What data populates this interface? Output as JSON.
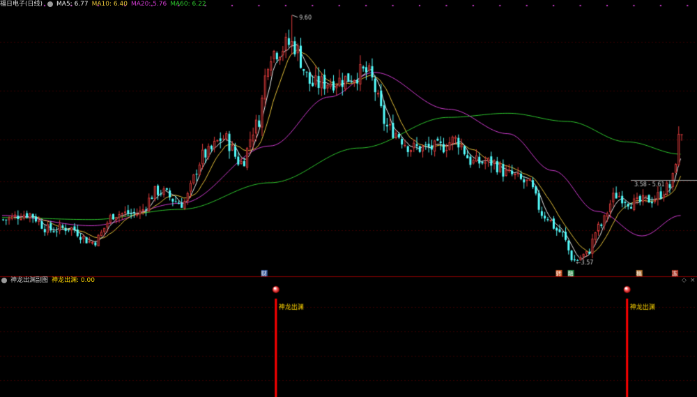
{
  "header": {
    "title": "福日电子(日线)",
    "ma": [
      {
        "label": "MA5: 6.77",
        "color": "#f0f0f0"
      },
      {
        "label": "MA10: 6.40",
        "color": "#e8c33a"
      },
      {
        "label": "MA20: 5.76",
        "color": "#d23cd2"
      },
      {
        "label": "MA60: 6.22",
        "color": "#2ec82e"
      }
    ]
  },
  "indicator": {
    "title": "神龙出渊副图",
    "value_label": "神龙出渊: 0.00",
    "signal_text": "神龙出渊",
    "signals": [
      92,
      210
    ]
  },
  "events": [
    {
      "index": 88,
      "text": "财",
      "color": "#ffffff",
      "bg": "#335599"
    },
    {
      "index": 187,
      "text": "转",
      "color": "#ffffff",
      "bg": "#cc5522"
    },
    {
      "index": 191,
      "text": "融",
      "color": "#ffffff",
      "bg": "#228844"
    },
    {
      "index": 214,
      "text": "稿",
      "color": "#ffffff",
      "bg": "#aa6622"
    },
    {
      "index": 226,
      "text": "冻",
      "color": "#ffffff",
      "bg": "#aa3322"
    }
  ],
  "annotations": {
    "high_label": "9.60",
    "low_label": "3.57",
    "range_label": "3.58 - 5.61"
  },
  "colors": {
    "up": "#e03c3c",
    "down": "#54ffff",
    "bg": "#000000",
    "panel_line": "#8b0000",
    "grid": "#3a0000",
    "ma5": "#f0f0f0",
    "ma10": "#e8c33a",
    "ma20": "#d23cd2",
    "ma60": "#2ec82e",
    "signal": "#ff0000",
    "signal_text": "#ffd700"
  },
  "chart_data": {
    "type": "candlestick",
    "price_range": [
      3.4,
      9.8
    ],
    "anchors": [
      [
        0,
        4.6
      ],
      [
        8,
        4.75
      ],
      [
        16,
        4.35
      ],
      [
        22,
        4.4
      ],
      [
        30,
        4.05
      ],
      [
        38,
        4.75
      ],
      [
        45,
        4.75
      ],
      [
        52,
        5.3
      ],
      [
        60,
        5.0
      ],
      [
        68,
        6.2
      ],
      [
        74,
        6.6
      ],
      [
        80,
        6.0
      ],
      [
        85,
        6.9
      ],
      [
        90,
        8.7
      ],
      [
        97,
        8.9
      ],
      [
        104,
        7.9
      ],
      [
        112,
        8.0
      ],
      [
        122,
        8.2
      ],
      [
        130,
        6.8
      ],
      [
        138,
        6.35
      ],
      [
        146,
        6.35
      ],
      [
        152,
        6.55
      ],
      [
        158,
        6.0
      ],
      [
        164,
        6.0
      ],
      [
        170,
        5.7
      ],
      [
        176,
        5.5
      ],
      [
        182,
        4.7
      ],
      [
        187,
        4.3
      ],
      [
        192,
        3.6
      ],
      [
        196,
        3.75
      ],
      [
        200,
        4.4
      ],
      [
        206,
        5.2
      ],
      [
        212,
        5.0
      ],
      [
        218,
        5.1
      ],
      [
        224,
        5.4
      ],
      [
        228,
        6.77
      ]
    ],
    "ma60_anchors": [
      [
        0,
        4.65
      ],
      [
        30,
        4.6
      ],
      [
        60,
        4.85
      ],
      [
        90,
        5.5
      ],
      [
        120,
        6.35
      ],
      [
        150,
        7.1
      ],
      [
        170,
        7.2
      ],
      [
        190,
        7.0
      ],
      [
        210,
        6.5
      ],
      [
        228,
        6.2
      ]
    ],
    "ma20_anchors": [
      [
        0,
        4.7
      ],
      [
        30,
        4.45
      ],
      [
        60,
        5.0
      ],
      [
        90,
        6.4
      ],
      [
        110,
        7.6
      ],
      [
        125,
        8.2
      ],
      [
        150,
        7.3
      ],
      [
        170,
        6.7
      ],
      [
        185,
        5.8
      ],
      [
        200,
        4.8
      ],
      [
        215,
        4.2
      ],
      [
        228,
        4.7
      ]
    ]
  }
}
